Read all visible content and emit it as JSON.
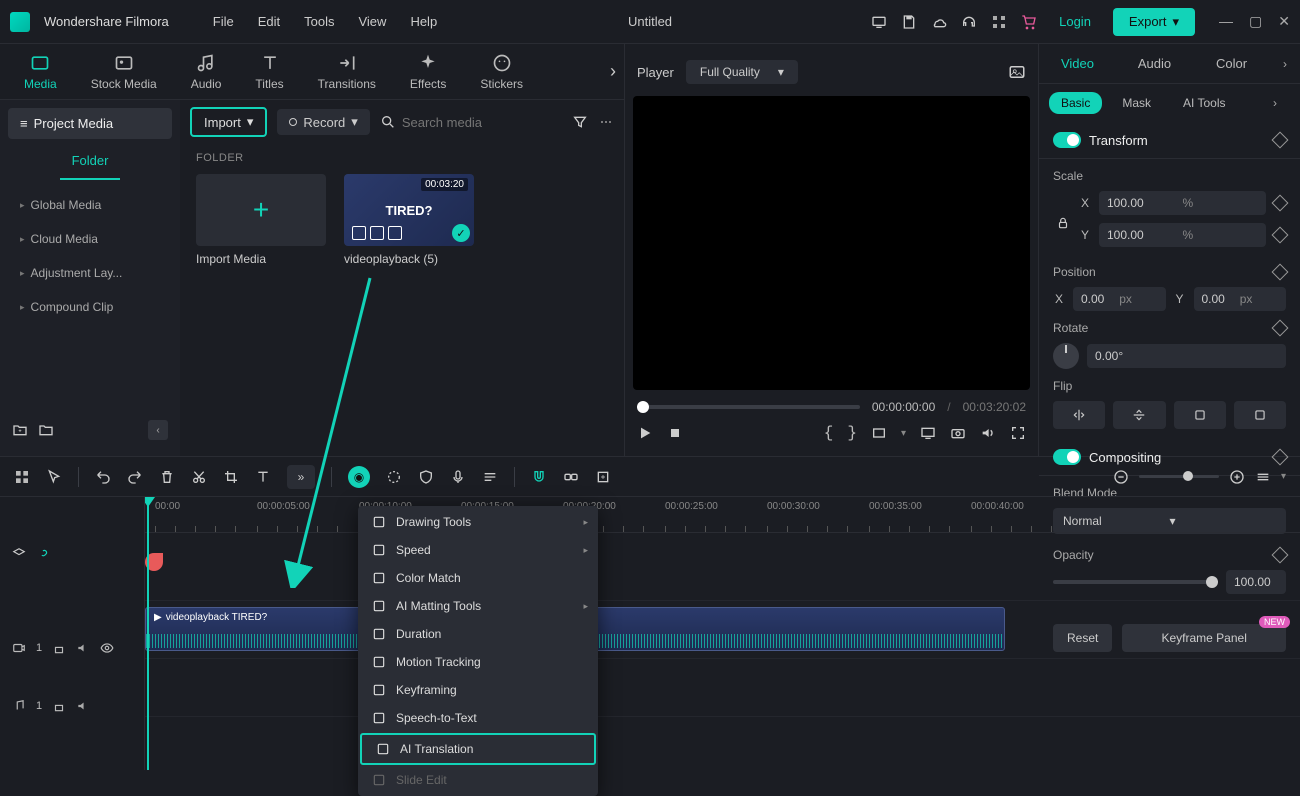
{
  "app": {
    "name": "Wondershare Filmora",
    "document": "Untitled"
  },
  "menubar": [
    "File",
    "Edit",
    "Tools",
    "View",
    "Help"
  ],
  "titlebar": {
    "login": "Login",
    "export": "Export"
  },
  "tabs": [
    "Media",
    "Stock Media",
    "Audio",
    "Titles",
    "Transitions",
    "Effects",
    "Stickers"
  ],
  "sidebar": {
    "project": "Project Media",
    "folder_tab": "Folder",
    "items": [
      "Global Media",
      "Cloud Media",
      "Adjustment Lay...",
      "Compound Clip"
    ]
  },
  "toolbar": {
    "import": "Import",
    "record": "Record",
    "search_placeholder": "Search media",
    "folder_label": "FOLDER"
  },
  "media": {
    "import_caption": "Import Media",
    "clip": {
      "duration": "00:03:20",
      "caption": "videoplayback (5)",
      "thumb_text": "TIRED?"
    }
  },
  "player": {
    "label": "Player",
    "quality": "Full Quality",
    "time_current": "00:00:00:00",
    "time_total": "00:03:20:02"
  },
  "inspector": {
    "tabs": [
      "Video",
      "Audio",
      "Color"
    ],
    "subtabs": [
      "Basic",
      "Mask",
      "AI Tools"
    ],
    "transform": {
      "title": "Transform",
      "scale_label": "Scale",
      "scale_x": "100.00",
      "scale_y": "100.00",
      "scale_unit": "%",
      "position_label": "Position",
      "pos_x": "0.00",
      "pos_y": "0.00",
      "pos_unit": "px",
      "rotate_label": "Rotate",
      "rotate_val": "0.00°",
      "flip_label": "Flip"
    },
    "compositing": {
      "title": "Compositing",
      "blend_label": "Blend Mode",
      "blend_value": "Normal",
      "opacity_label": "Opacity",
      "opacity_value": "100.00"
    },
    "footer": {
      "reset": "Reset",
      "keyframe": "Keyframe Panel",
      "new_badge": "NEW"
    }
  },
  "timeline": {
    "ruler": [
      "00:00",
      "00:00:05:00",
      "00:00:10:00",
      "00:00:15:00",
      "00:00:20:00",
      "00:00:25:00",
      "00:00:30:00",
      "00:00:35:00",
      "00:00:40:00"
    ],
    "clip_label": "videoplayback TIRED?",
    "video_track": "1",
    "audio_track": "1"
  },
  "context_menu": [
    {
      "label": "Drawing Tools",
      "sub": true
    },
    {
      "label": "Speed",
      "sub": true
    },
    {
      "label": "Color Match"
    },
    {
      "label": "AI Matting Tools",
      "sub": true
    },
    {
      "label": "Duration"
    },
    {
      "label": "Motion Tracking"
    },
    {
      "label": "Keyframing"
    },
    {
      "label": "Speech-to-Text"
    },
    {
      "label": "AI Translation",
      "highlight": true
    },
    {
      "label": "Slide Edit",
      "disabled": true
    }
  ],
  "axis": {
    "x": "X",
    "y": "Y"
  }
}
